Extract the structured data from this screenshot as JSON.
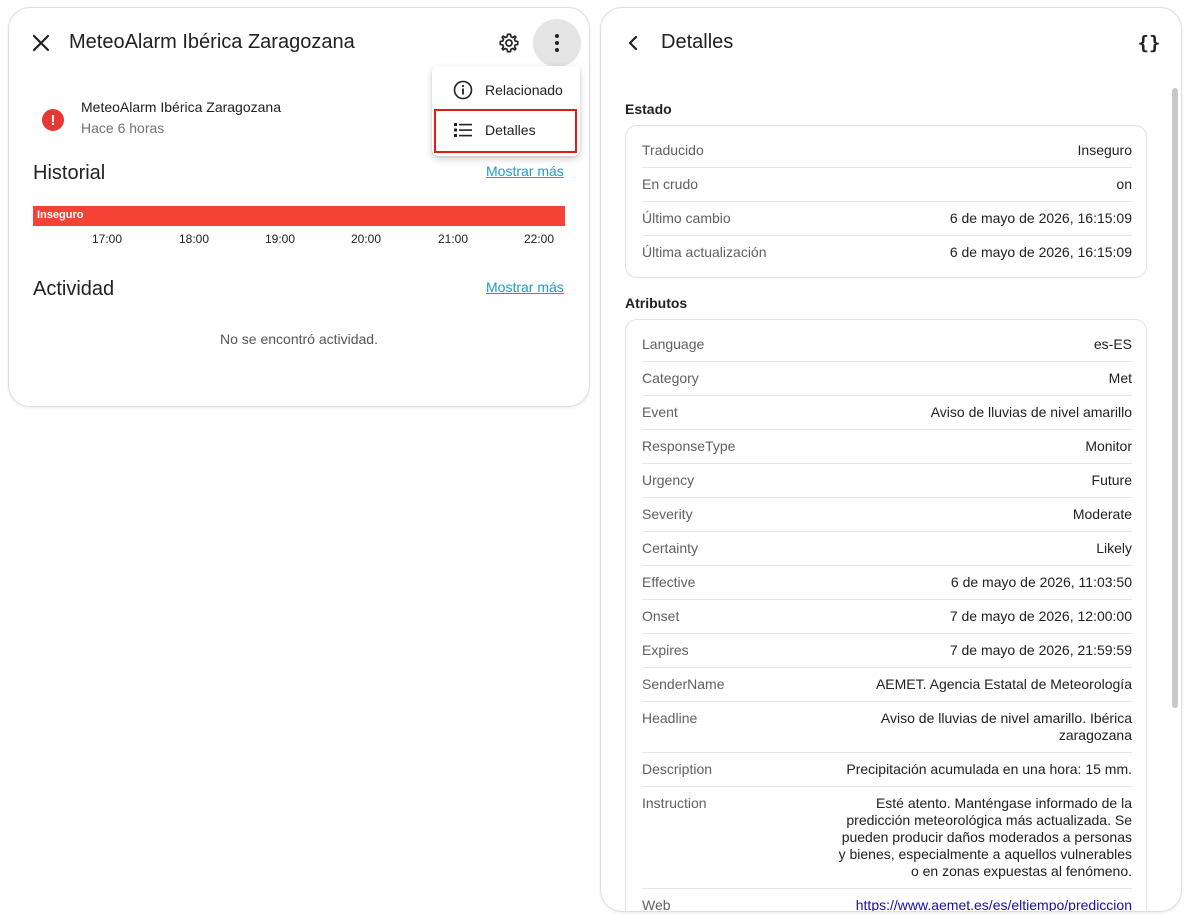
{
  "left_dialog": {
    "title": "MeteoAlarm Ibérica Zaragozana",
    "entity": {
      "name": "MeteoAlarm Ibérica Zaragozana",
      "last_changed": "Hace 6 horas",
      "state_icon_glyph": "!",
      "state_color": "#e53935"
    },
    "history": {
      "title": "Historial",
      "show_more": "Mostrar más",
      "bar_label": "Inseguro",
      "bar_color": "#f44336",
      "ticks": [
        "17:00",
        "18:00",
        "19:00",
        "20:00",
        "21:00",
        "22:00"
      ]
    },
    "activity": {
      "title": "Actividad",
      "show_more": "Mostrar más",
      "empty_text": "No se encontró actividad."
    },
    "icons": {
      "close": "close-icon",
      "settings": "gear-icon",
      "more": "dots-vertical-icon"
    }
  },
  "menu": {
    "items": [
      {
        "label": "Relacionado",
        "icon": "info-circle-icon"
      },
      {
        "label": "Detalles",
        "icon": "list-icon"
      }
    ]
  },
  "right_dialog": {
    "title": "Detalles",
    "json_button": "{}",
    "estado": {
      "label": "Estado",
      "rows": [
        {
          "k": "Traducido",
          "v": "Inseguro"
        },
        {
          "k": "En crudo",
          "v": "on"
        },
        {
          "k": "Último cambio",
          "v": "6 de mayo de 2026, 16:15:09"
        },
        {
          "k": "Última actualización",
          "v": "6 de mayo de 2026, 16:15:09"
        }
      ]
    },
    "atributos": {
      "label": "Atributos",
      "rows": [
        {
          "k": "Language",
          "v": "es-ES"
        },
        {
          "k": "Category",
          "v": "Met"
        },
        {
          "k": "Event",
          "v": "Aviso de lluvias de nivel amarillo"
        },
        {
          "k": "ResponseType",
          "v": "Monitor"
        },
        {
          "k": "Urgency",
          "v": "Future"
        },
        {
          "k": "Severity",
          "v": "Moderate"
        },
        {
          "k": "Certainty",
          "v": "Likely"
        },
        {
          "k": "Effective",
          "v": "6 de mayo de 2026, 11:03:50"
        },
        {
          "k": "Onset",
          "v": "7 de mayo de 2026, 12:00:00"
        },
        {
          "k": "Expires",
          "v": "7 de mayo de 2026, 21:59:59"
        },
        {
          "k": "SenderName",
          "v": "AEMET. Agencia Estatal de Meteorología"
        },
        {
          "k": "Headline",
          "v": "Aviso de lluvias de nivel amarillo. Ibérica\nzaragozana"
        },
        {
          "k": "Description",
          "v": "Precipitación acumulada en una hora: 15 mm."
        },
        {
          "k": "Instruction",
          "v": "Esté atento. Manténgase informado de la\npredicción meteorológica más actualizada. Se\npueden producir daños moderados a personas\ny bienes, especialmente a aquellos vulnerables\no en zonas expuestas al fenómeno."
        },
        {
          "k": "Web",
          "v": "https://www.aemet.es/es/eltiempo/prediccion"
        }
      ]
    },
    "icons": {
      "back": "chevron-left-icon",
      "json": "code-braces-icon"
    }
  }
}
